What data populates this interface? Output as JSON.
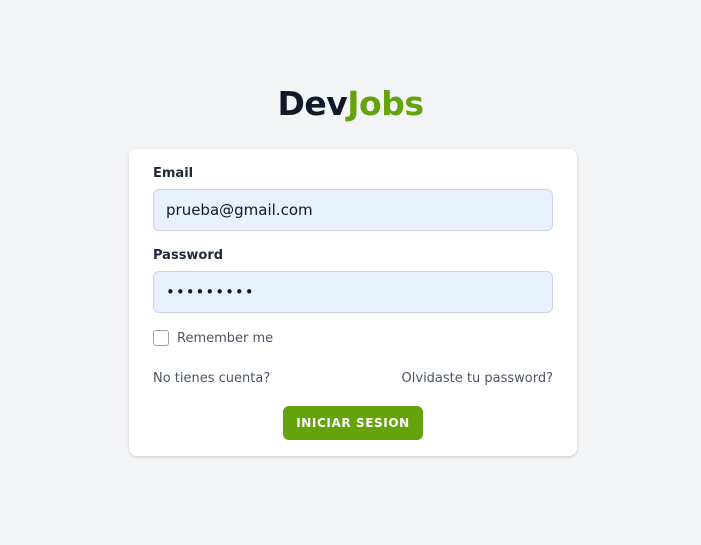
{
  "logo": {
    "part1": "Dev",
    "part2": "Jobs",
    "part1_color": "#111827",
    "part2_color": "#65a30d"
  },
  "form": {
    "email_label": "Email",
    "email_value": "prueba@gmail.com",
    "password_label": "Password",
    "password_masked": "•••••••••",
    "remember_label": "Remember me",
    "remember_checked": false,
    "signup_link": "No tienes cuenta?",
    "forgot_link": "Olvidaste tu password?",
    "submit_label": "INICIAR SESION",
    "submit_color": "#65a30d",
    "input_bg_color": "#e8f0fe"
  }
}
